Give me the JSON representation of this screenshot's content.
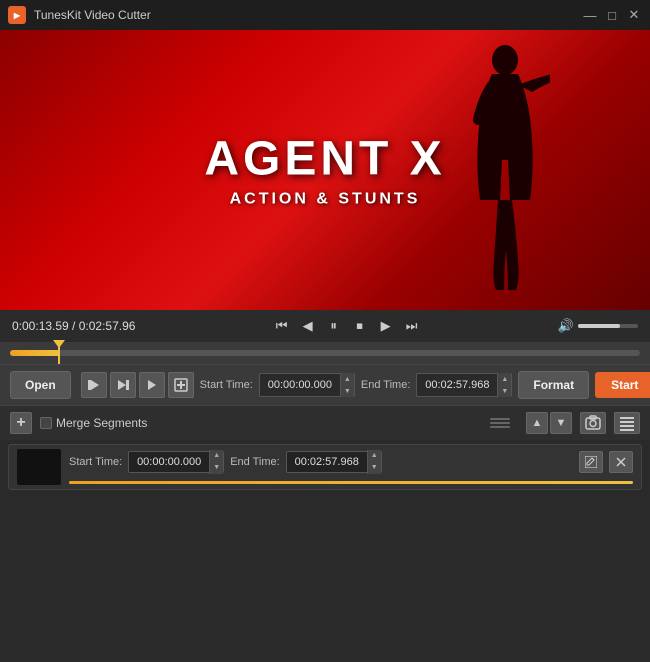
{
  "titleBar": {
    "appName": "TunesKit Video Cutter",
    "icon": "TK",
    "controls": {
      "minimize": "—",
      "maximize": "□",
      "close": "✕"
    }
  },
  "videoPreview": {
    "title": "AGENT X",
    "subtitle": "ACTION & STUNTS",
    "bgColor": "#cc0000"
  },
  "playbackBar": {
    "timeDisplay": "0:00:13.59 / 0:02:57.96",
    "volumeLevel": 70
  },
  "controls": {
    "openLabel": "Open",
    "startTimeLabel": "Start Time:",
    "startTimeValue": "00:00:00.000",
    "endTimeLabel": "End Time:",
    "endTimeValue": "00:02:57.968",
    "formatLabel": "Format",
    "startLabel": "Start"
  },
  "segmentsBar": {
    "mergeLabel": "Merge Segments"
  },
  "segmentRow": {
    "startTimeLabel": "Start Time:",
    "startTimeValue": "00:00:00.000",
    "endTimeLabel": "End Time:",
    "endTimeValue": "00:02:57.968"
  }
}
